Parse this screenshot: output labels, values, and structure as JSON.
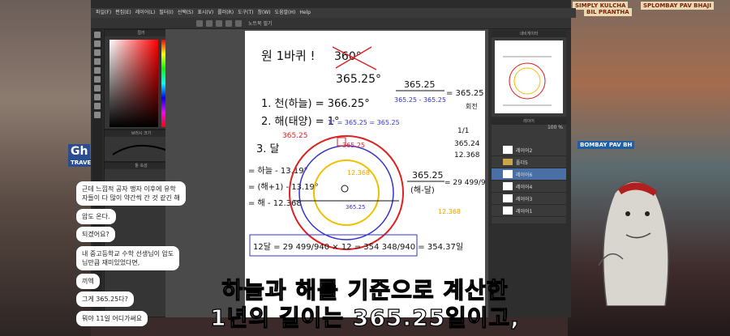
{
  "background_signs": {
    "right_top": "SIMPLY KULCHA",
    "right_top2": "SPLOMBAY PAV BHAJI",
    "right_top3": "BIL PRANTHA",
    "bombay": "BOMBAY PAV BH",
    "left_travel": "TRAVEL",
    "left_gh": "Gh"
  },
  "app": {
    "menu": [
      "파일(F)",
      "편집(E)",
      "레이어(L)",
      "필터(I)",
      "선택(S)",
      "표시(V)",
      "룰러(R)",
      "도구(T)",
      "창(W)",
      "도움말(H)",
      "Help"
    ],
    "toolbar_name": "노트북 필기",
    "panels": {
      "color": "컬러",
      "brush_size": "브러시 크기",
      "tool_property": "툴 속성",
      "navigator": "내비게이터",
      "layer": "레이어"
    },
    "layers": [
      {
        "name": "레이어2",
        "selected": false
      },
      {
        "name": "폴더5",
        "selected": false
      },
      {
        "name": "레이어6",
        "selected": true
      },
      {
        "name": "레이어4",
        "selected": false
      },
      {
        "name": "레이어3",
        "selected": false
      },
      {
        "name": "레이어1",
        "selected": false
      }
    ],
    "layer_opacity": "100 %",
    "accent_color": "#4a6fa5"
  },
  "whiteboard": {
    "title_a": "원 1바퀴 !",
    "title_b": "360°",
    "title_c": "365.25°",
    "item1": "1. 천(하늘) = 366.25°",
    "item2": "2. 해(태양) = 1°",
    "item2b": "365.25",
    "item3": "3. 달",
    "moon_a": "= 하늘 - 13.19°",
    "moon_b": "= (해+1) - 13.19°",
    "moon_c": "= 해 - 12.368",
    "circle_top": "1° = 365.25 = 365.25",
    "circle_label": "365.25",
    "circle_inner": "12.368",
    "circle_bottom": "365.25",
    "frac_top": "365.25",
    "frac_bottom": "365.25 - 365.25",
    "frac_eq": "= 365.25",
    "frac_label": "회전",
    "ratio_a": "1/1",
    "ratio_b": "365.24",
    "ratio_c": "12.368",
    "frac2_top": "365.25",
    "frac2_bottom": "(해-달)",
    "frac2_eq": "= 29 499/940",
    "frac2_label": "12.368",
    "bottom_eq": "12달 = 29 499/940 × 12 = 354 348/940 = 354.37일"
  },
  "chat": [
    "근데 느낌적 공자 맹자 이후에 유학\n자들이 다 많이 약간씩 간 것 같긴 해",
    "압도 온다.",
    "되겠어요?",
    "내 중고등학교 수학 선생님이 압도\n님만큼 재미있었다면,",
    "끼엑",
    "그게 365.25다?",
    "뭐야 11일 어디가써요"
  ],
  "subtitle": {
    "line1": "하늘과 해를 기준으로 계산한",
    "line2": "1년의 길이는 365.25일이고,"
  }
}
